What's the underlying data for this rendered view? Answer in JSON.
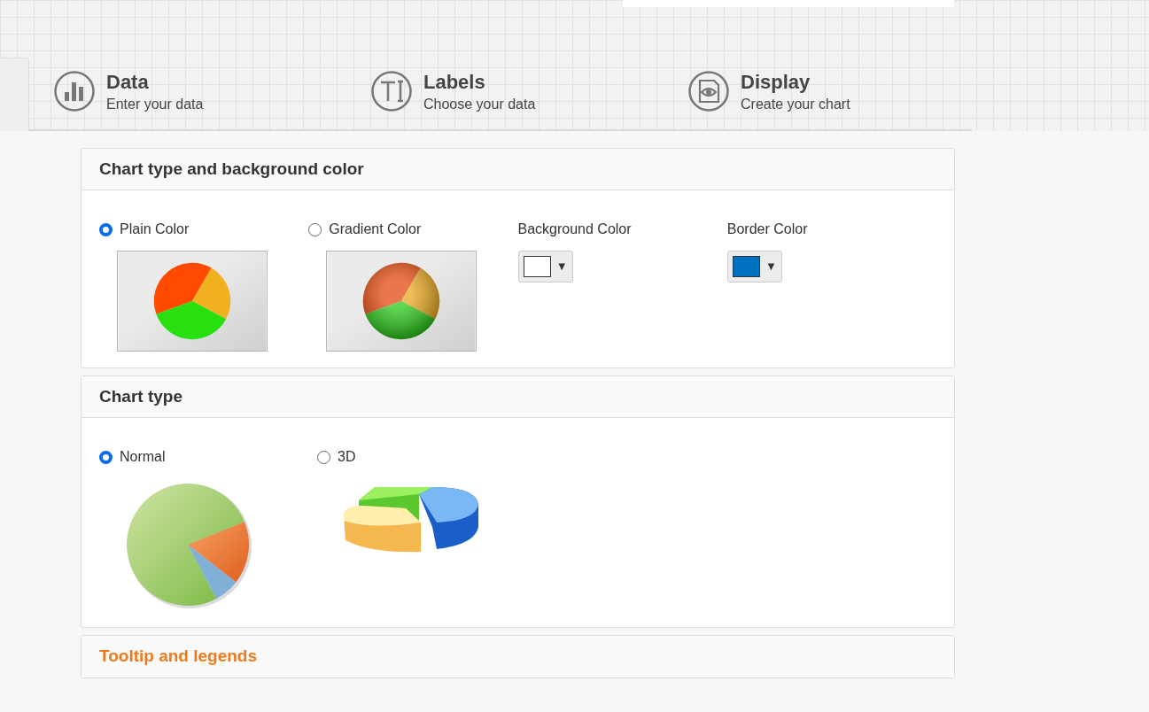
{
  "steps": [
    {
      "kind": "data",
      "title": "Data",
      "subtitle": "Enter your data"
    },
    {
      "kind": "labels",
      "title": "Labels",
      "subtitle": "Choose your data"
    },
    {
      "kind": "display",
      "title": "Display",
      "subtitle": "Create your chart"
    }
  ],
  "sections": [
    {
      "title": "Chart type and background color",
      "expanded": true,
      "items": [
        {
          "kind": "radio",
          "label": "Plain Color",
          "selected": true
        },
        {
          "kind": "radio",
          "label": "Gradient Color",
          "selected": false
        },
        {
          "kind": "color",
          "label": "Background Color",
          "color": "#ffffff",
          "arrow": "▼"
        },
        {
          "kind": "color",
          "label": "Border Color",
          "color": "#0070c0",
          "arrow": "▼"
        }
      ]
    },
    {
      "title": "Chart type",
      "expanded": true,
      "items": [
        {
          "kind": "radio",
          "label": "Normal",
          "selected": true
        },
        {
          "kind": "radio",
          "label": "3D",
          "selected": false
        }
      ]
    },
    {
      "title": "Tooltip and legends",
      "expanded": false
    }
  ]
}
